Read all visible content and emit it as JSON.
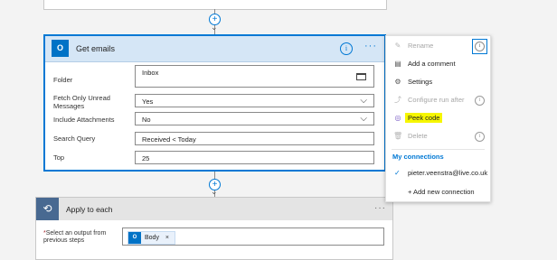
{
  "get_emails": {
    "title": "Get emails",
    "icon": "outlook-icon",
    "icon_text": "O",
    "more_glyph": "···",
    "info_glyph": "i",
    "fields": [
      {
        "label": "Folder",
        "value": "Inbox",
        "control": "folder-picker"
      },
      {
        "label": "Fetch Only Unread Messages",
        "value": "Yes",
        "control": "dropdown"
      },
      {
        "label": "Include Attachments",
        "value": "No",
        "control": "dropdown"
      },
      {
        "label": "Search Query",
        "value": "Received < Today",
        "control": "text"
      },
      {
        "label": "Top",
        "value": "25",
        "control": "text"
      }
    ]
  },
  "connector": {
    "plus_glyph": "+",
    "arrow_glyph": "⌄"
  },
  "apply_to_each": {
    "title": "Apply to each",
    "more_glyph": "···",
    "loop_icon_glyph": "⟲",
    "required_mark": "*",
    "output_label": "Select an output from previous steps",
    "token_label": "Body",
    "token_remove": "×"
  },
  "menu": {
    "items": [
      {
        "label": "Rename",
        "icon": "pencil-icon",
        "glyph": "✎",
        "disabled": true
      },
      {
        "label": "Add a comment",
        "icon": "comment-icon",
        "glyph": "▤",
        "disabled": false
      },
      {
        "label": "Settings",
        "icon": "gear-icon",
        "glyph": "⚙",
        "disabled": false
      },
      {
        "label": "Configure run after",
        "icon": "run-after-icon",
        "glyph": "⤴",
        "disabled": true
      },
      {
        "label": "Peek code",
        "icon": "peek-code-icon",
        "glyph": "◎",
        "disabled": false,
        "highlighted": true
      },
      {
        "label": "Delete",
        "icon": "trash-icon",
        "glyph": "🗑",
        "disabled": true
      }
    ],
    "section_title": "My connections",
    "connections": [
      {
        "label": "pieter.veenstra@live.co.uk",
        "selected": true
      }
    ],
    "add_connection": "+ Add new connection"
  },
  "colors": {
    "accent": "#0078d4",
    "outlook": "#0072c6",
    "highlight": "#f6f600",
    "loop": "#486991"
  }
}
